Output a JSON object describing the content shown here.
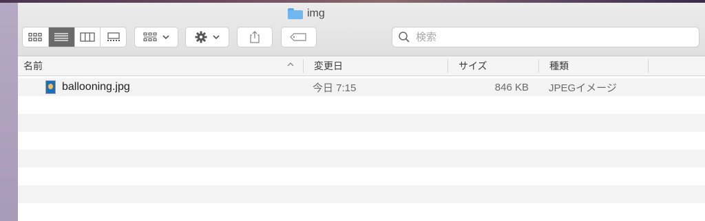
{
  "window": {
    "title": "img",
    "folder_icon": "folder-icon"
  },
  "toolbar": {
    "views": [
      "icon-view-icon",
      "list-view-icon",
      "column-view-icon",
      "gallery-view-icon"
    ],
    "active_view": "list-view-icon",
    "arrange_icon": "grid-arrange-icon",
    "action_icon": "gear-icon",
    "share_icon": "share-icon",
    "tag_icon": "tag-icon"
  },
  "search": {
    "placeholder": "検索",
    "icon": "search-icon"
  },
  "columns": {
    "name": "名前",
    "date": "変更日",
    "size": "サイズ",
    "kind": "種類"
  },
  "files": [
    {
      "name": "ballooning.jpg",
      "date": "今日 7:15",
      "size": "846 KB",
      "kind": "JPEGイメージ"
    }
  ]
}
